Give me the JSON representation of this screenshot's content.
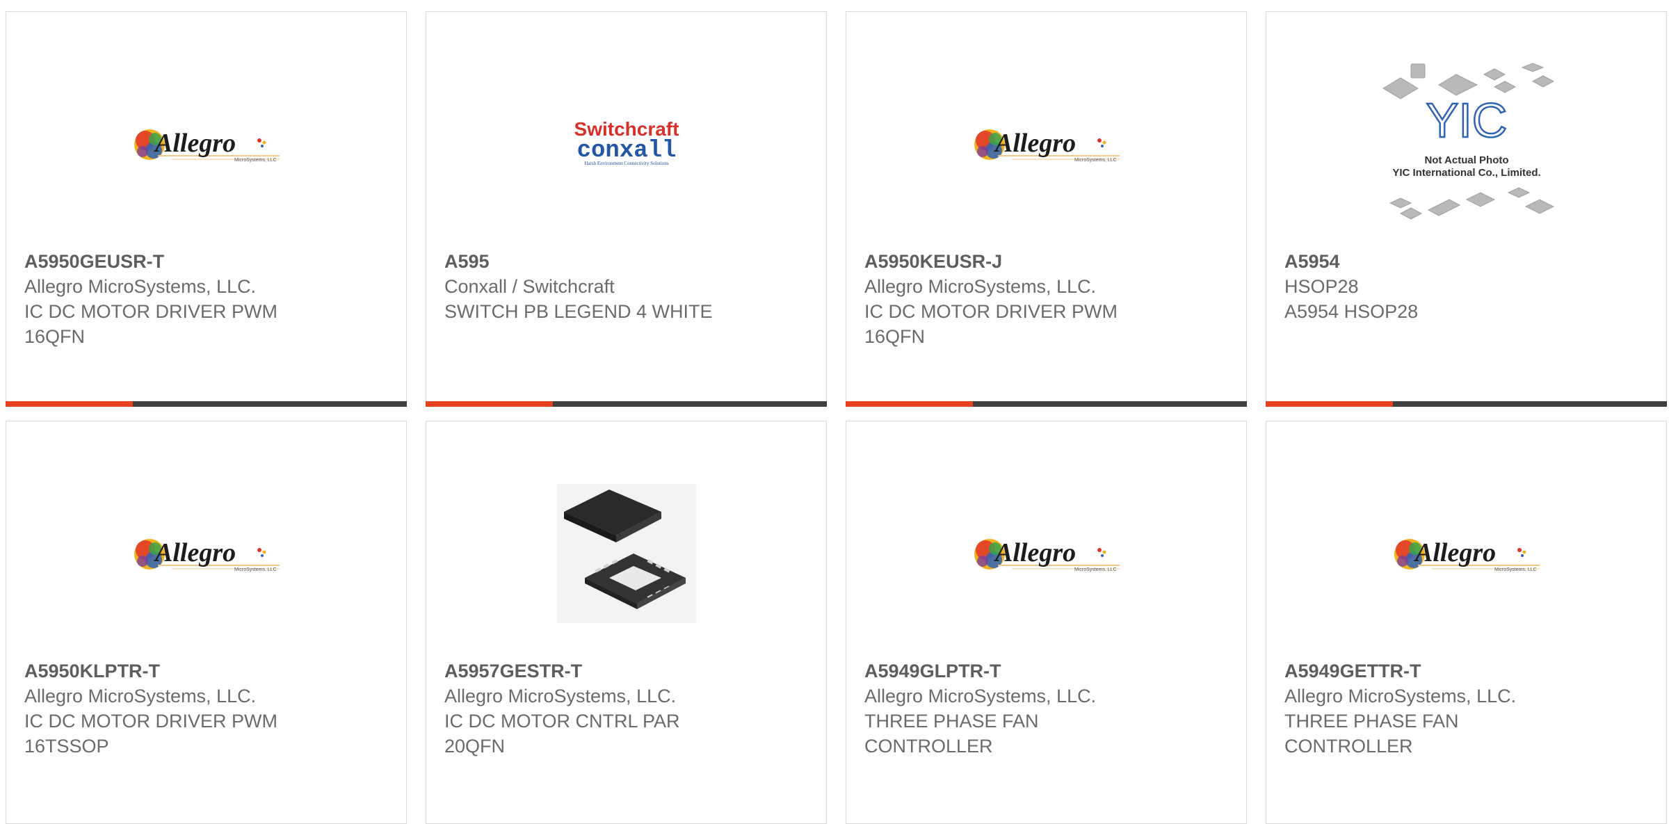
{
  "products": [
    {
      "part": "A5950GEUSR-T",
      "manufacturer": "Allegro MicroSystems, LLC.",
      "description": "IC DC MOTOR DRIVER PWM 16QFN",
      "image": "allegro-logo",
      "image_text": "Allegro",
      "image_subtext": "MicroSystems, LLC"
    },
    {
      "part": "A595",
      "manufacturer": "Conxall / Switchcraft",
      "description": "SWITCH PB LEGEND 4 WHITE",
      "image": "switchcraft-conxall-logo",
      "image_text": "Switchcraft",
      "image_text2": "conxall",
      "image_subtext": "Harsh Environment Connectivity Solutions"
    },
    {
      "part": "A5950KEUSR-J",
      "manufacturer": "Allegro MicroSystems, LLC.",
      "description": "IC DC MOTOR DRIVER PWM 16QFN",
      "image": "allegro-logo",
      "image_text": "Allegro",
      "image_subtext": "MicroSystems, LLC"
    },
    {
      "part": "A5954",
      "manufacturer": "HSOP28",
      "description": "A5954 HSOP28",
      "image": "yic-placeholder",
      "image_text": "YIC",
      "image_note1": "Not Actual Photo",
      "image_note2": "YIC International Co., Limited."
    },
    {
      "part": "A5950KLPTR-T",
      "manufacturer": "Allegro MicroSystems, LLC.",
      "description": "IC DC MOTOR DRIVER PWM 16TSSOP",
      "image": "allegro-logo",
      "image_text": "Allegro",
      "image_subtext": "MicroSystems, LLC"
    },
    {
      "part": "A5957GESTR-T",
      "manufacturer": "Allegro MicroSystems, LLC.",
      "description": "IC DC MOTOR CNTRL PAR 20QFN",
      "image": "qfn-chip-photo"
    },
    {
      "part": "A5949GLPTR-T",
      "manufacturer": "Allegro MicroSystems, LLC.",
      "description": "THREE PHASE FAN CONTROLLER",
      "image": "allegro-logo",
      "image_text": "Allegro",
      "image_subtext": "MicroSystems, LLC"
    },
    {
      "part": "A5949GETTR-T",
      "manufacturer": "Allegro MicroSystems, LLC.",
      "description": "THREE PHASE FAN CONTROLLER",
      "image": "allegro-logo",
      "image_text": "Allegro",
      "image_subtext": "MicroSystems, LLC"
    }
  ],
  "colors": {
    "accent": "#e8401c",
    "bar": "#3f3f3f",
    "text": "#6b6b6b",
    "border": "#d9d9d9"
  }
}
